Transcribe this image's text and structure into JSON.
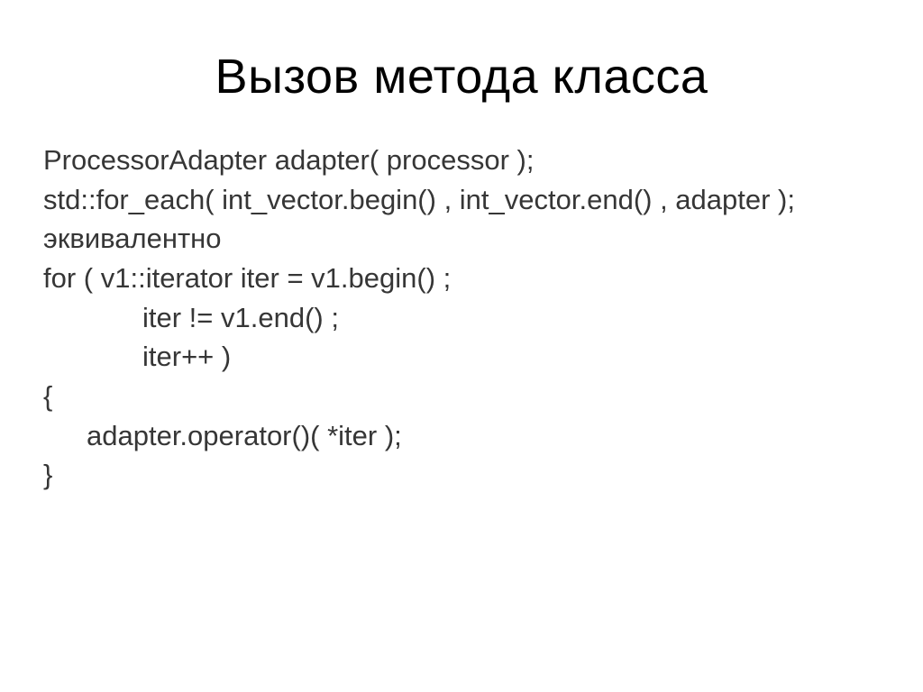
{
  "title": "Вызов метода класса",
  "lines": {
    "l1": "ProcessorAdapter adapter( processor );",
    "l2": "std::for_each( int_vector.begin() , int_vector.end() , adapter );",
    "l3": "эквивалентно",
    "l4": "for ( v1::iterator iter = v1.begin() ;",
    "l5": "iter != v1.end() ;",
    "l6": "iter++ )",
    "l7": "{",
    "l8": "adapter.operator()( *iter );",
    "l9": "}"
  }
}
